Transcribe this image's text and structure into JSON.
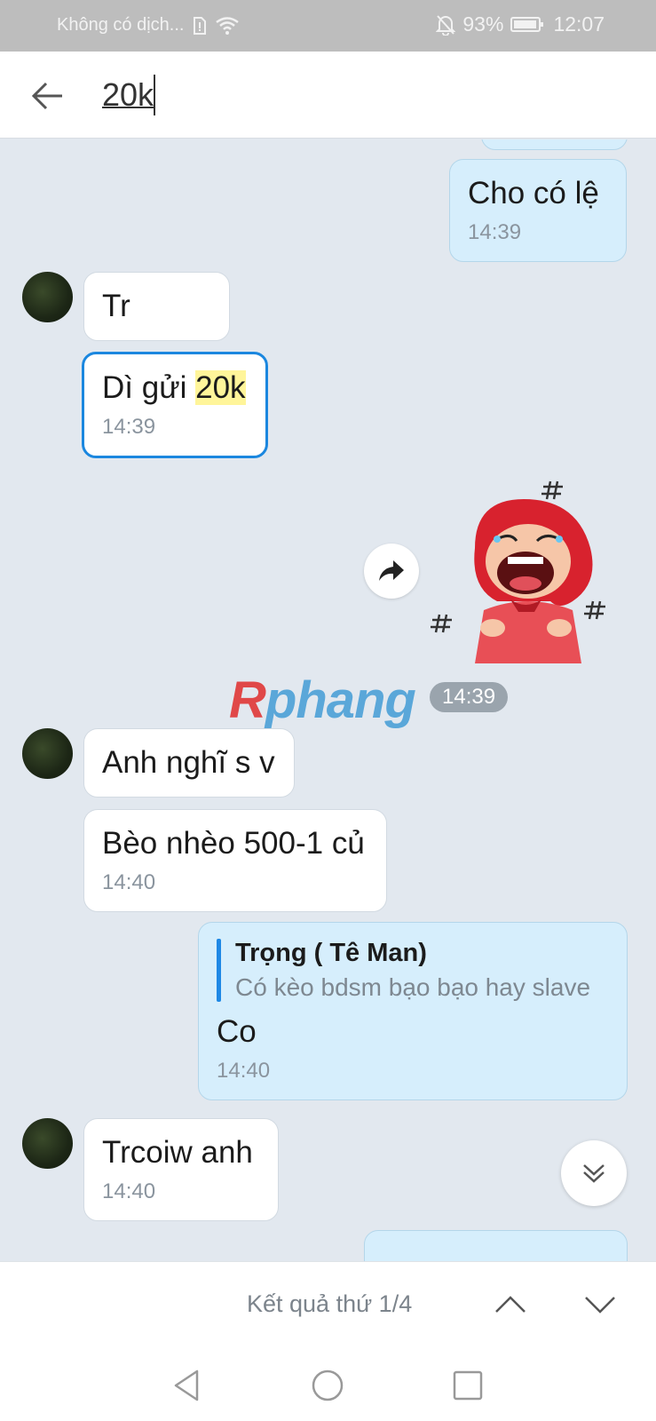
{
  "status_bar": {
    "carrier": "Không có dịch...",
    "battery": "93%",
    "time": "12:07"
  },
  "search": {
    "query": "20k"
  },
  "messages": [
    {
      "text": "Cho có lệ",
      "time": "14:39"
    },
    {
      "text": "Tr"
    },
    {
      "text_prefix": "Dì gửi ",
      "text_match": "20k",
      "time": "14:39"
    },
    {
      "sticker_time": "14:39"
    },
    {
      "text": "Anh nghĩ s v"
    },
    {
      "text": "Bèo nhèo 500-1 củ",
      "time": "14:40"
    },
    {
      "quote_name": "Trọng ( Tê Man)",
      "quote_text": "Có kèo bdsm bạo bạo hay slave",
      "text": "Co",
      "time": "14:40"
    },
    {
      "text": "Trcoiw anh",
      "time": "14:40"
    }
  ],
  "watermark": {
    "part1": "R",
    "part2": "phang"
  },
  "result_bar": {
    "label": "Kết quả thứ 1/4"
  },
  "icons": {
    "back": "back-arrow-icon",
    "forward": "share-forward-icon",
    "scroll_down": "double-chevron-down-icon",
    "up": "chevron-up-icon",
    "down": "chevron-down-icon",
    "nav_back": "triangle-back-icon",
    "nav_home": "circle-home-icon",
    "nav_recents": "square-recents-icon"
  }
}
